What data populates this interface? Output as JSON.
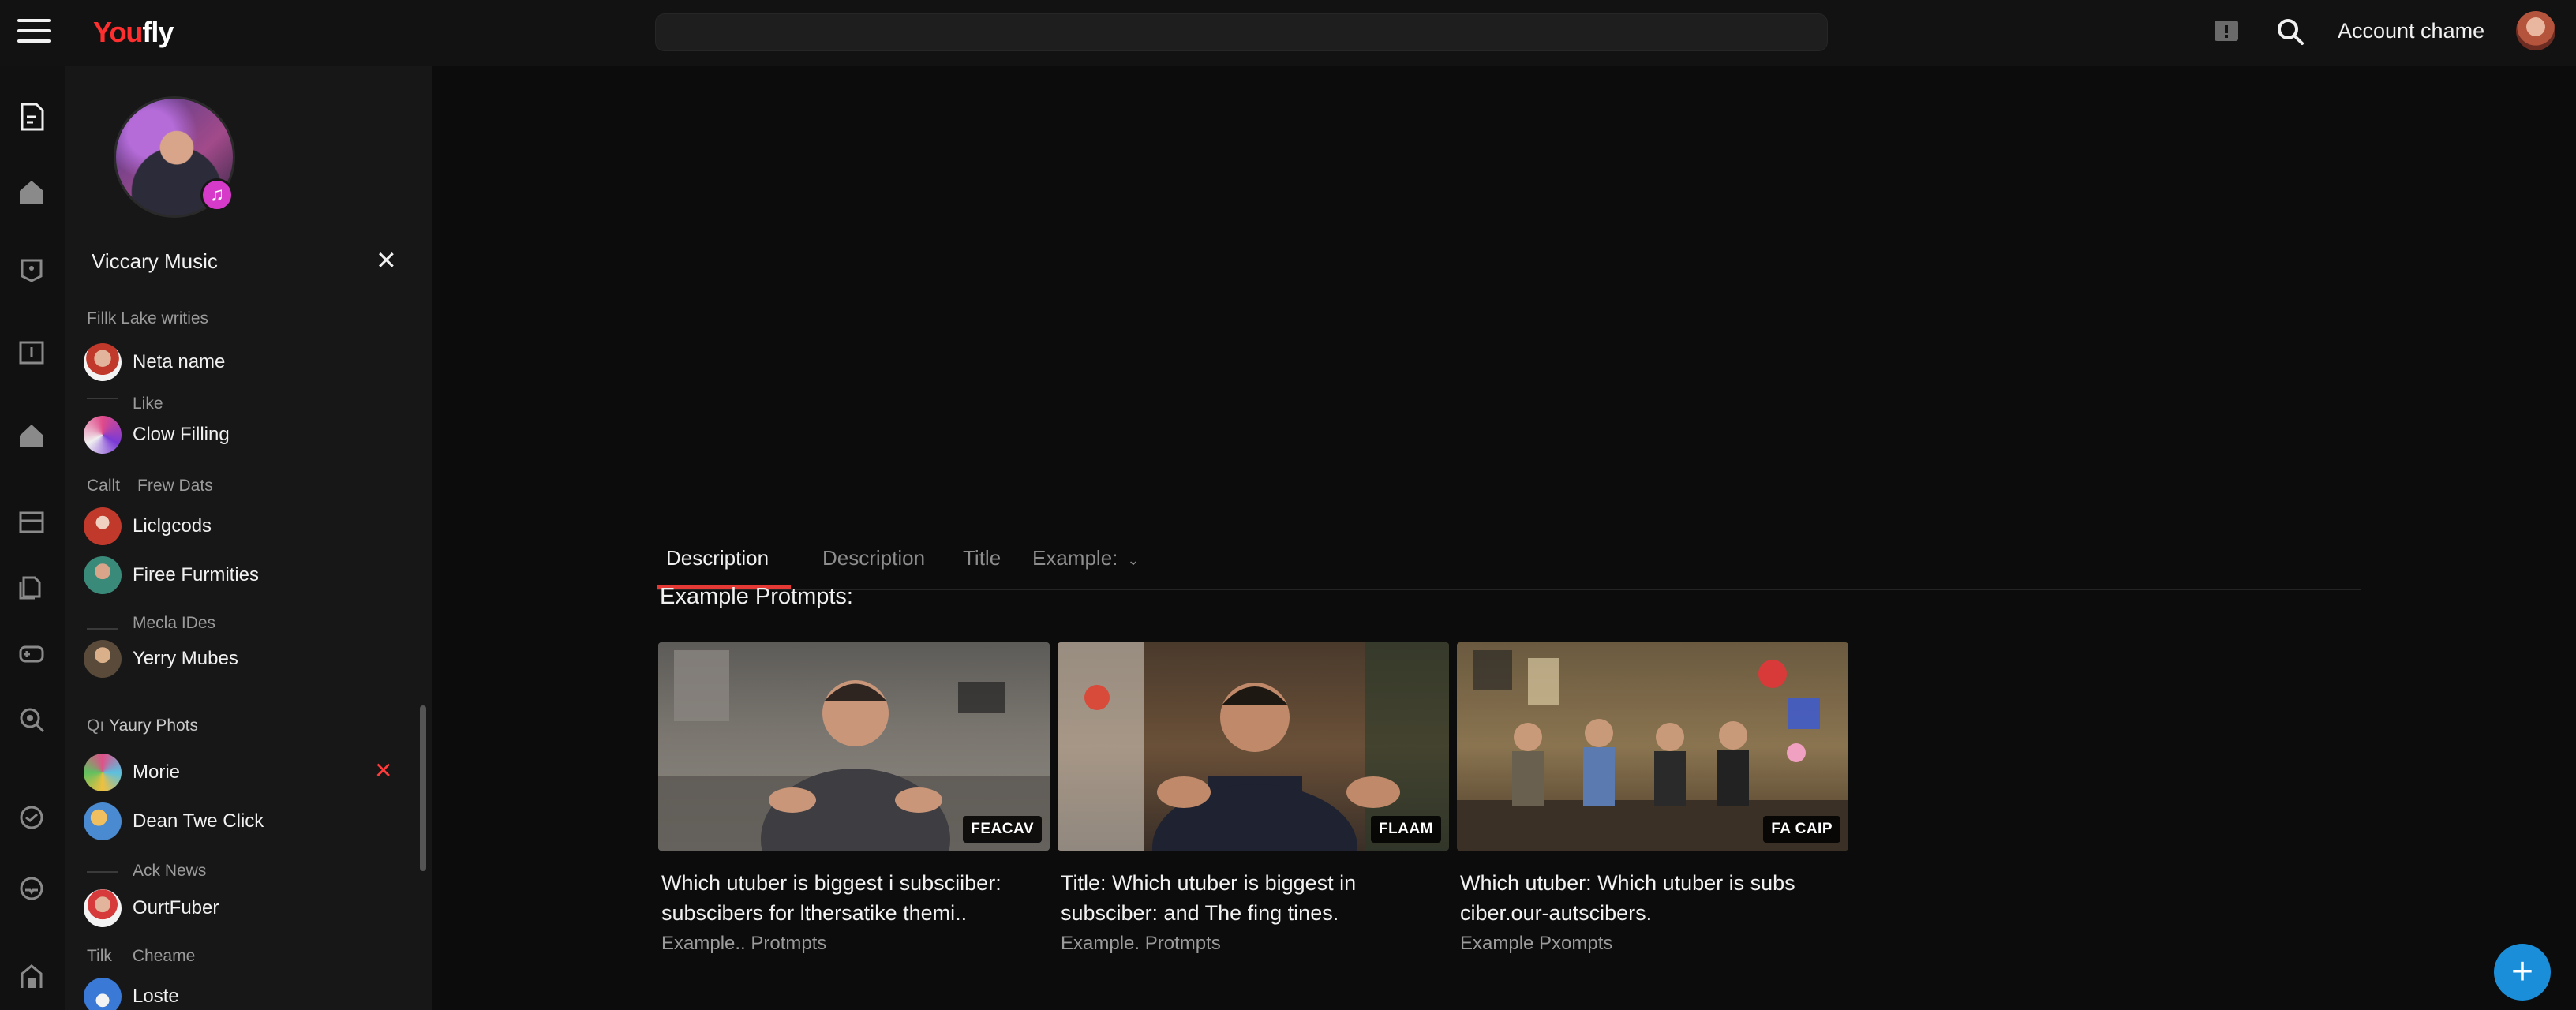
{
  "header": {
    "logo_part1": "You",
    "logo_part2": "fly",
    "search_placeholder": "",
    "account_name": "Account chame"
  },
  "channel": {
    "name": "Viccary Music"
  },
  "sidebar": {
    "groups": [
      {
        "label": "Fillk Lake writies",
        "prefix": ""
      },
      {
        "label": "Like",
        "prefix": ""
      },
      {
        "label": "Frew Dats",
        "prefix": "Callt"
      },
      {
        "label": "Mecla IDes",
        "prefix": ""
      },
      {
        "label": "Yaury Phots",
        "prefix": "Qı"
      },
      {
        "label": "Ack News",
        "prefix": ""
      },
      {
        "label": "Cheame",
        "prefix": "Tilk"
      }
    ],
    "items": [
      {
        "name": "Neta name"
      },
      {
        "name": "Clow Filling"
      },
      {
        "name": "Liclgcods"
      },
      {
        "name": "Firee Furmities"
      },
      {
        "name": "Yerry Mubes"
      },
      {
        "name": "Morie"
      },
      {
        "name": "Dean Twe Click"
      },
      {
        "name": "OurtFuber"
      },
      {
        "name": "Loste"
      }
    ]
  },
  "tabs": [
    {
      "label": "Description"
    },
    {
      "label": "Description"
    },
    {
      "label": "Title"
    },
    {
      "label": "Example:"
    }
  ],
  "section_title": "Example Protmpts:",
  "cards": [
    {
      "tag": "FEACAV",
      "title": "Which utuber is biggest i subsciiber: subscibers for lthersatike themi..",
      "meta": "Example.. Protmpts"
    },
    {
      "tag": "FLAAM",
      "title": "Title: Which utuber is biggest in subsciber: and The fing tines.",
      "meta": "Example.  Protmpts"
    },
    {
      "tag": "FA CAIP",
      "title": "Which utuber: Which utuber is subs ciber.our-autscibers.",
      "meta": "Example Pxompts"
    }
  ],
  "fab_symbol": "+",
  "colors": {
    "accent_red": "#e53935",
    "fab_blue": "#1a8ed8",
    "background": "#0f0f0f"
  }
}
